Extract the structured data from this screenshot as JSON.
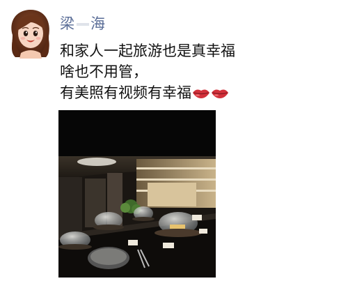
{
  "user": {
    "name_visible_first": "梁",
    "name_visible_last": "海",
    "name_censored": true,
    "avatar_icon": "cartoon-girl-avatar"
  },
  "post": {
    "lines": [
      "和家人一起旅游也是真幸福",
      "啥也不用管，",
      "有美照有视频有幸福"
    ],
    "trailing_emojis": [
      "lips-icon",
      "lips-icon"
    ]
  },
  "media": {
    "type": "video",
    "thumbnail_scene": "buffet-restaurant",
    "colors": {
      "background": "#060606",
      "accent": "#c9b38a"
    }
  }
}
